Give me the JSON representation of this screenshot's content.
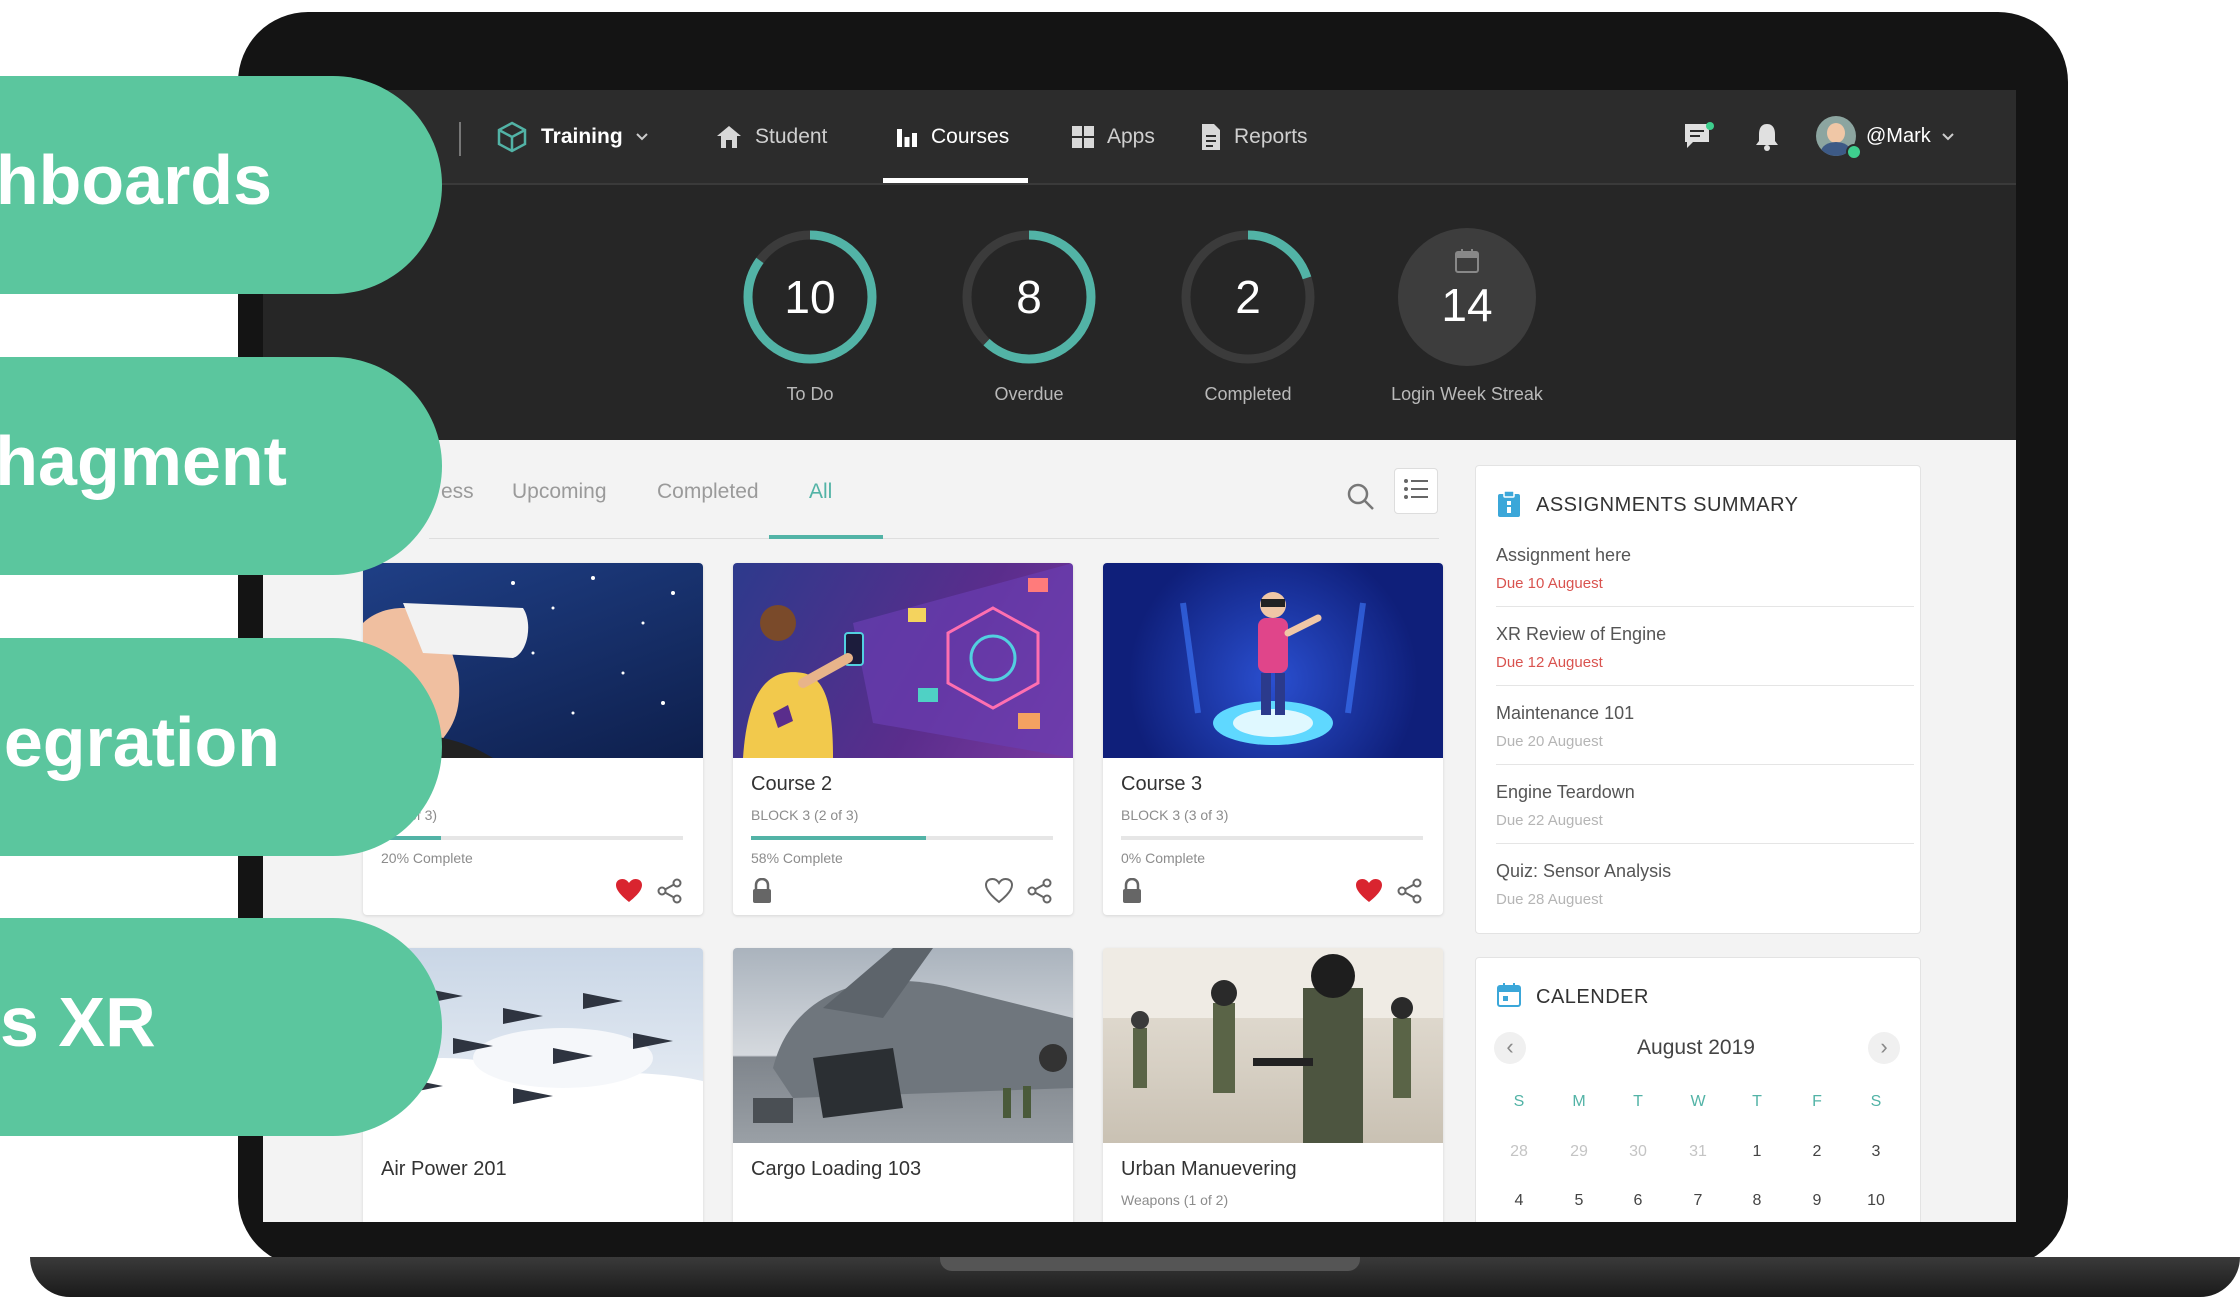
{
  "overlay_pills": [
    "hboards",
    "hagment",
    "egration",
    "s XR"
  ],
  "nav": {
    "training_label": "Training",
    "items": [
      {
        "label": "Student",
        "icon": "home-icon"
      },
      {
        "label": "Courses",
        "icon": "bar-chart-icon"
      },
      {
        "label": "Apps",
        "icon": "grid-icon"
      },
      {
        "label": "Reports",
        "icon": "document-icon"
      }
    ],
    "active": "Courses",
    "user_name": "@Mark"
  },
  "stats": [
    {
      "value": "10",
      "label": "To Do",
      "fill": 0.85
    },
    {
      "value": "8",
      "label": "Overdue",
      "fill": 0.62
    },
    {
      "value": "2",
      "label": "Completed",
      "fill": 0.2
    },
    {
      "value": "14",
      "label": "Login Week Streak"
    }
  ],
  "tabs": [
    "ess",
    "Upcoming",
    "Completed",
    "All"
  ],
  "active_tab": "All",
  "courses": [
    {
      "title": "e 1",
      "sub": "3 (1 of 3)",
      "progress_text": "20% Complete",
      "progress": 0.2,
      "locked": false,
      "favorite": true
    },
    {
      "title": "Course 2",
      "sub": "BLOCK 3 (2 of 3)",
      "progress_text": "58% Complete",
      "progress": 0.58,
      "locked": true,
      "favorite": false
    },
    {
      "title": "Course 3",
      "sub": "BLOCK 3 (3 of 3)",
      "progress_text": "0% Complete",
      "progress": 0,
      "locked": true,
      "favorite": true
    },
    {
      "title": "Air Power 201",
      "sub": ""
    },
    {
      "title": "Cargo Loading 103",
      "sub": ""
    },
    {
      "title": "Urban Manuevering",
      "sub": "Weapons (1 of 2)"
    }
  ],
  "assignments": {
    "title": "ASSIGNMENTS SUMMARY",
    "items": [
      {
        "title": "Assignment here",
        "due": "Due 10 Auguest",
        "overdue": true
      },
      {
        "title": "XR Review of Engine",
        "due": "Due 12 Auguest",
        "overdue": true
      },
      {
        "title": "Maintenance 101",
        "due": "Due 20 Auguest",
        "overdue": false
      },
      {
        "title": "Engine Teardown",
        "due": "Due 22 Auguest",
        "overdue": false
      },
      {
        "title": "Quiz: Sensor Analysis",
        "due": "Due 28 Auguest",
        "overdue": false
      }
    ]
  },
  "calendar": {
    "title": "CALENDER",
    "month": "August 2019",
    "weekdays": [
      "S",
      "M",
      "T",
      "W",
      "T",
      "F",
      "S"
    ],
    "weeks": [
      [
        {
          "d": "28",
          "m": true
        },
        {
          "d": "29",
          "m": true
        },
        {
          "d": "30",
          "m": true
        },
        {
          "d": "31",
          "m": true
        },
        {
          "d": "1"
        },
        {
          "d": "2"
        },
        {
          "d": "3"
        }
      ],
      [
        {
          "d": "4"
        },
        {
          "d": "5"
        },
        {
          "d": "6"
        },
        {
          "d": "7"
        },
        {
          "d": "8"
        },
        {
          "d": "9"
        },
        {
          "d": "10"
        }
      ]
    ]
  },
  "colors": {
    "accent": "#52b3a6",
    "pill": "#5bc69e",
    "due_red": "#d9534f",
    "due_gray": "#b5b5b5",
    "heart": "#d9242f"
  }
}
